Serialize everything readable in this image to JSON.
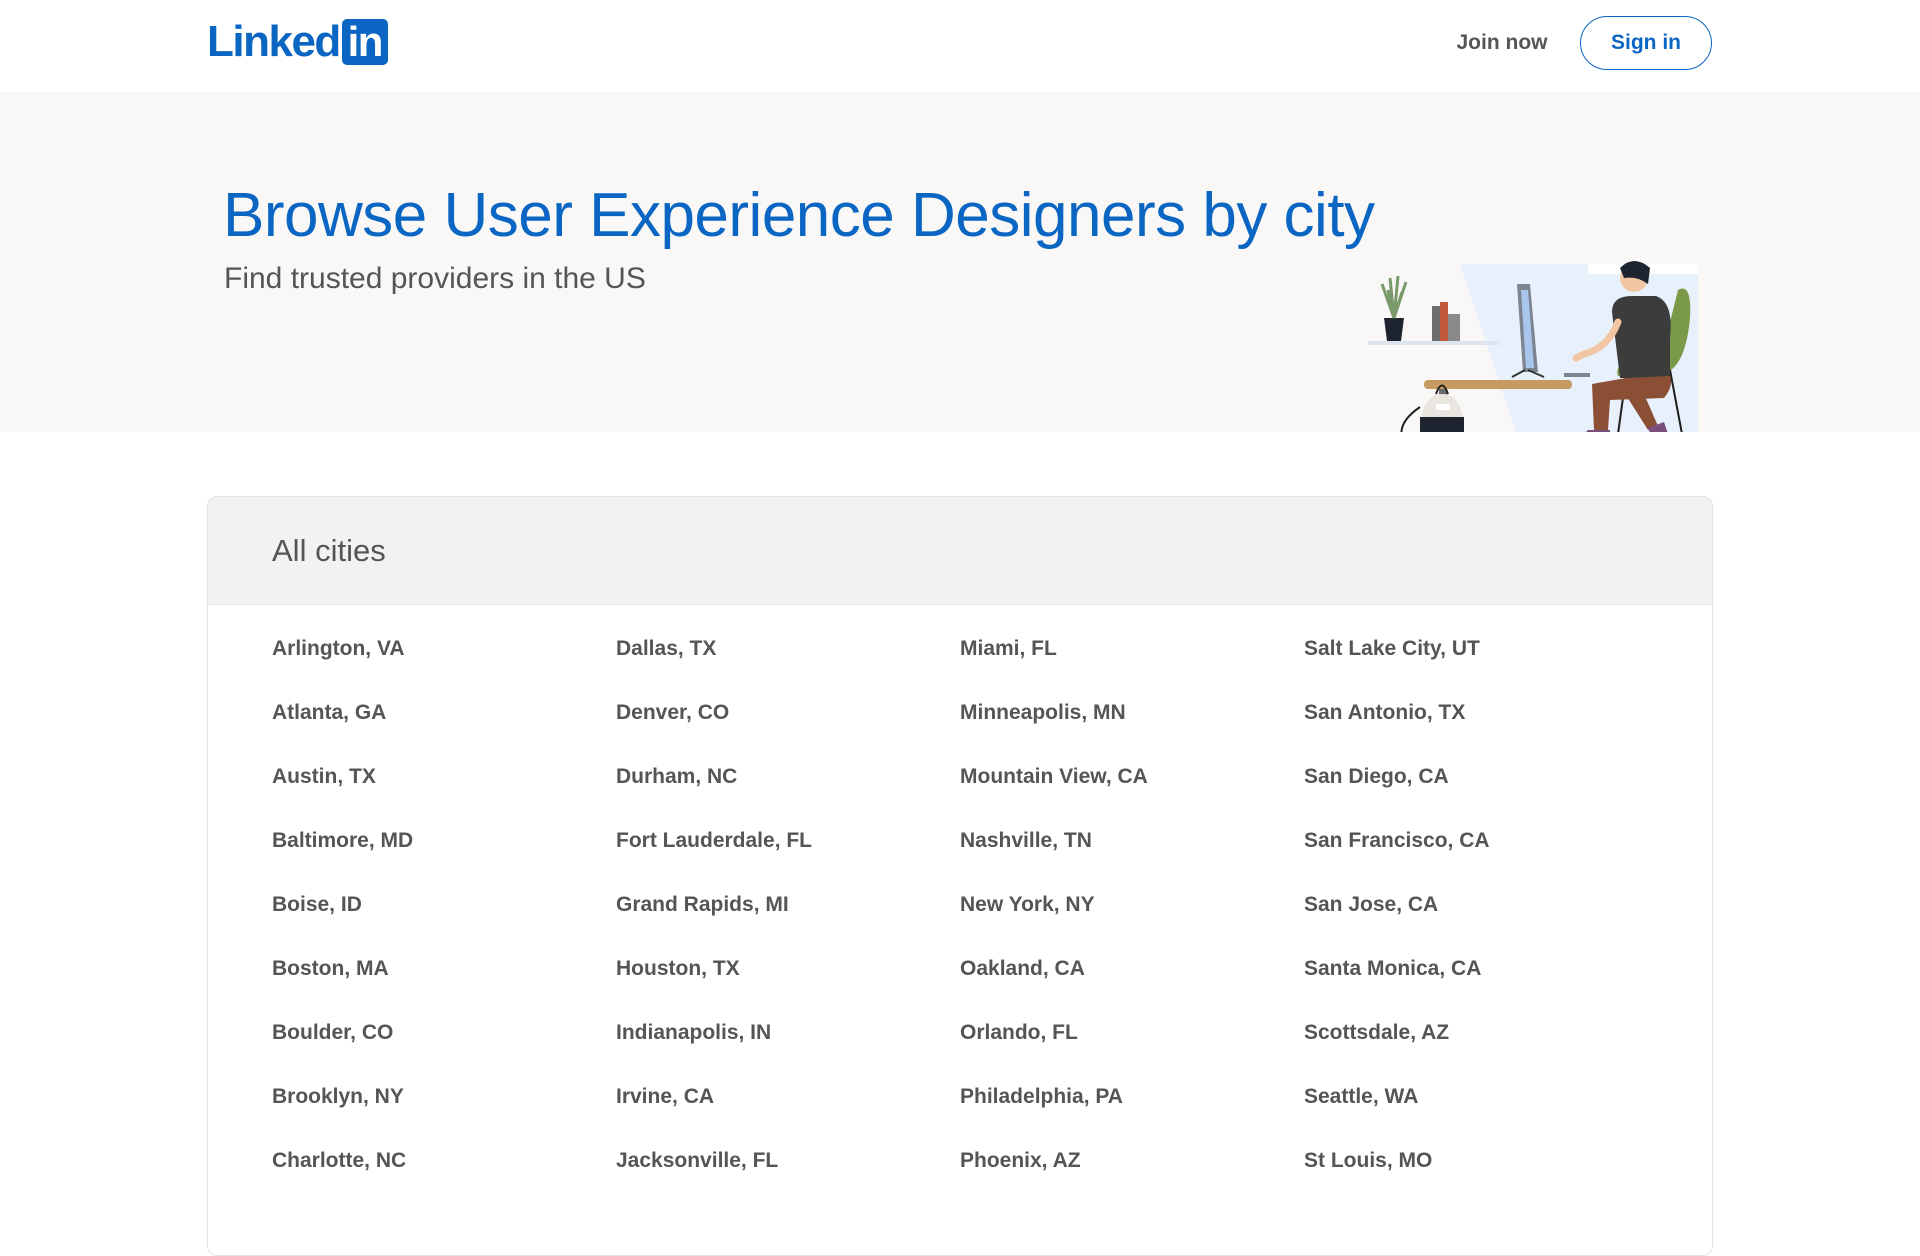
{
  "header": {
    "logo_text": "Linked",
    "logo_box": "in",
    "join_now": "Join now",
    "sign_in": "Sign in"
  },
  "hero": {
    "title": "Browse User Experience Designers by city",
    "subtitle": "Find trusted providers in the US"
  },
  "cities_section": {
    "title": "All cities",
    "columns": [
      [
        "Arlington, VA",
        "Atlanta, GA",
        "Austin, TX",
        "Baltimore, MD",
        "Boise, ID",
        "Boston, MA",
        "Boulder, CO",
        "Brooklyn, NY",
        "Charlotte, NC"
      ],
      [
        "Dallas, TX",
        "Denver, CO",
        "Durham, NC",
        "Fort Lauderdale, FL",
        "Grand Rapids, MI",
        "Houston, TX",
        "Indianapolis, IN",
        "Irvine, CA",
        "Jacksonville, FL"
      ],
      [
        "Miami, FL",
        "Minneapolis, MN",
        "Mountain View, CA",
        "Nashville, TN",
        "New York, NY",
        "Oakland, CA",
        "Orlando, FL",
        "Philadelphia, PA",
        "Phoenix, AZ"
      ],
      [
        "Salt Lake City, UT",
        "San Antonio, TX",
        "San Diego, CA",
        "San Francisco, CA",
        "San Jose, CA",
        "Santa Monica, CA",
        "Scottsdale, AZ",
        "Seattle, WA",
        "St Louis, MO"
      ]
    ]
  },
  "colors": {
    "brand": "#0a66c2",
    "text": "#555555",
    "hero_bg": "#f9f8f7",
    "card_header_bg": "#f3f2f0"
  },
  "icons": {
    "illustration": "person-at-desk-illustration"
  }
}
